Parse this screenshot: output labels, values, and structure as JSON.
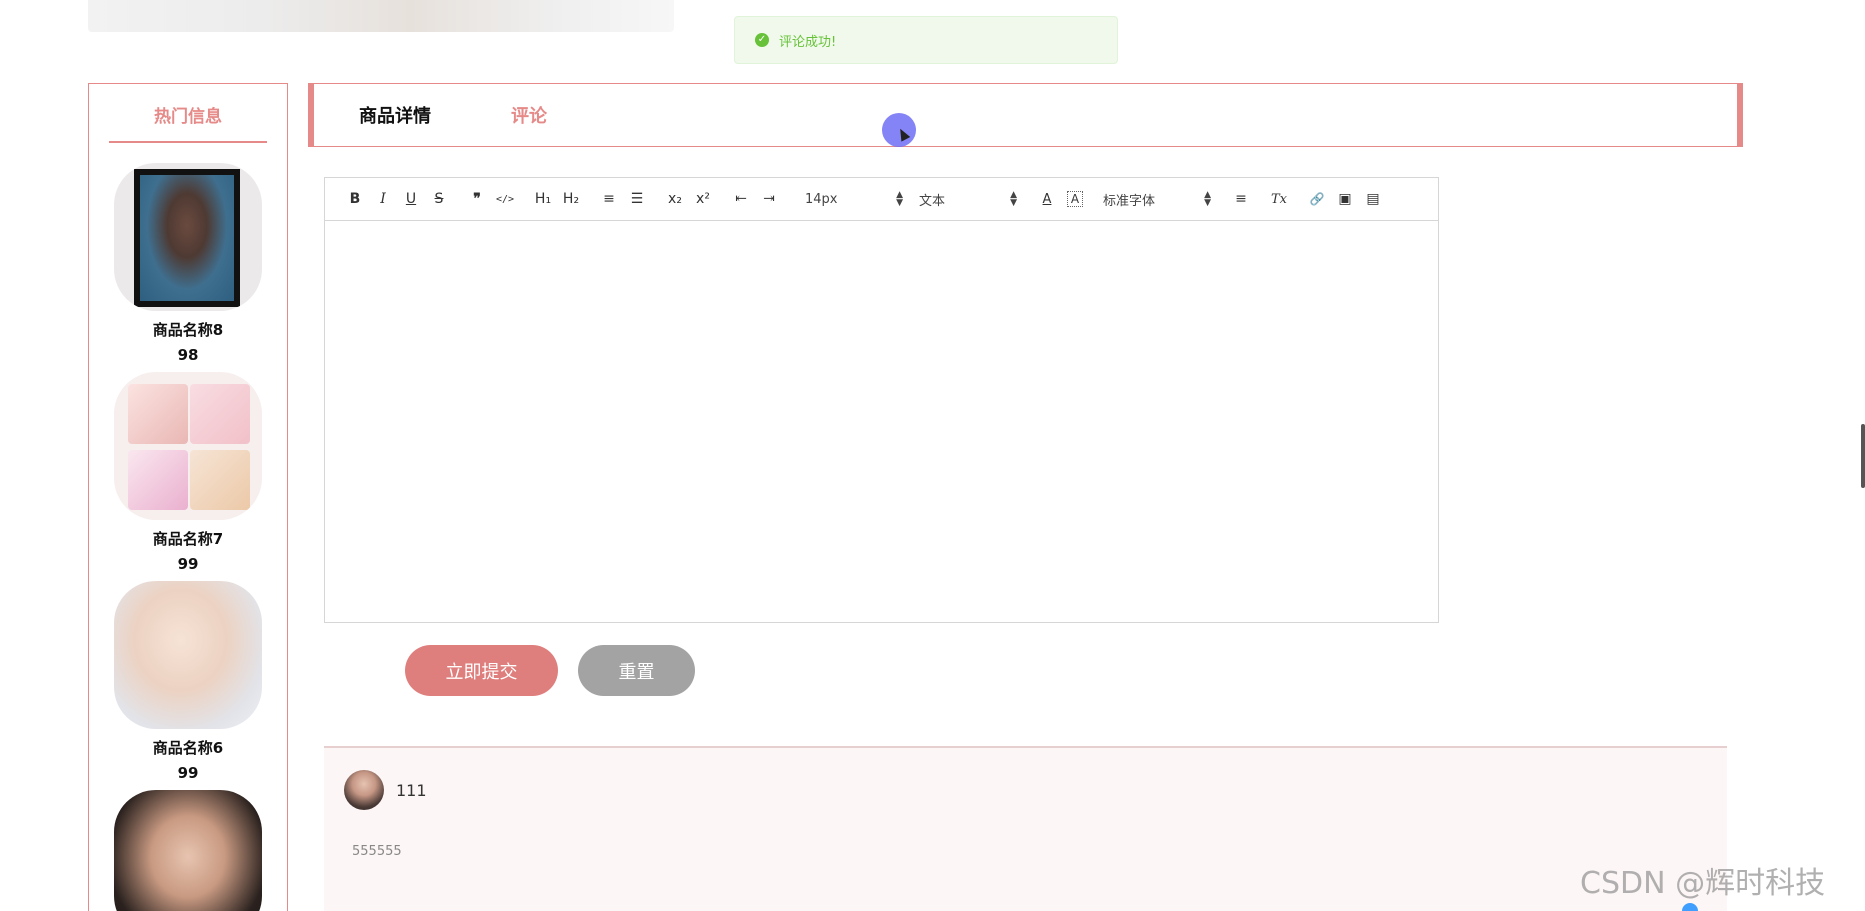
{
  "toast": {
    "message": "评论成功!",
    "icon": "success-check-icon",
    "color": "#67c23a"
  },
  "sidebar": {
    "title": "热门信息",
    "items": [
      {
        "name": "商品名称8",
        "price": "98"
      },
      {
        "name": "商品名称7",
        "price": "99"
      },
      {
        "name": "商品名称6",
        "price": "99"
      },
      {
        "name": "",
        "price": ""
      }
    ]
  },
  "tabs": {
    "detail": "商品详情",
    "comment": "评论"
  },
  "editor": {
    "toolbar": {
      "bold": "B",
      "italic": "I",
      "underline": "U",
      "strike": "S",
      "quote": "❞",
      "code": "</>",
      "h1": "H₁",
      "h2": "H₂",
      "ordered_list": "≡",
      "bullet_list": "☰",
      "subscript": "x₂",
      "superscript": "x²",
      "outdent": "⇤",
      "indent": "⇥",
      "size": "14px",
      "header": "文本",
      "font": "标准字体",
      "color": "A",
      "background": "A",
      "align": "≡",
      "clean": "Tx",
      "link": "🔗",
      "image": "▣",
      "video": "▤"
    }
  },
  "buttons": {
    "submit": "立即提交",
    "reset": "重置"
  },
  "comments": [
    {
      "user": "111",
      "content": "555555"
    }
  ],
  "watermark": "CSDN @辉时科技",
  "colors": {
    "accent": "#e58a88",
    "submit": "#df7f7d",
    "reset": "#a3a3a3",
    "comment_bg": "#fdf6f6"
  }
}
